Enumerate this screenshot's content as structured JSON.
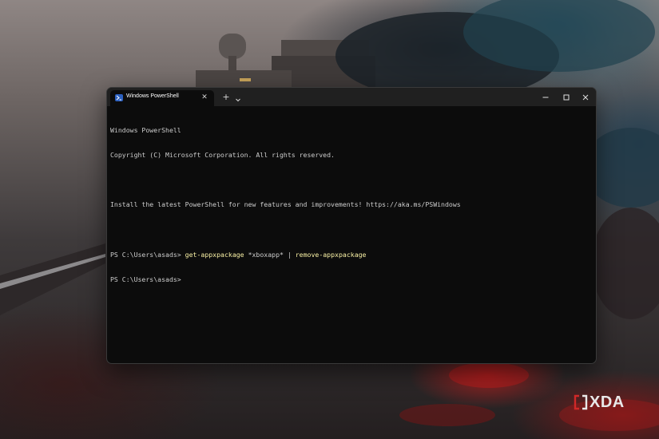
{
  "window": {
    "tab_title": "Windows PowerShell",
    "new_tab_symbol": "+",
    "close_symbol": "✕"
  },
  "console": {
    "lines": [
      "Windows PowerShell",
      "Copyright (C) Microsoft Corporation. All rights reserved.",
      "",
      "Install the latest PowerShell for new features and improvements! https://aka.ms/PSWindows",
      ""
    ],
    "prompt": "PS C:\\Users\\asads>",
    "command": {
      "cmdlet1": "get-appxpackage",
      "argument": "*xboxapp*",
      "pipe": "|",
      "cmdlet2": "remove-appxpackage"
    },
    "prompt2": "PS C:\\Users\\asads>"
  },
  "watermark": {
    "text": "XDA"
  },
  "colors": {
    "terminal_bg": "#0c0c0c",
    "titlebar_bg": "#202020",
    "text": "#cccccc",
    "cmdlet": "#f9f1a5"
  },
  "icons": {
    "tab": "powershell-icon",
    "minimize": "minimize-icon",
    "maximize": "maximize-icon",
    "close": "close-icon",
    "dropdown": "chevron-down-icon",
    "logo": "xda-logo-icon"
  }
}
